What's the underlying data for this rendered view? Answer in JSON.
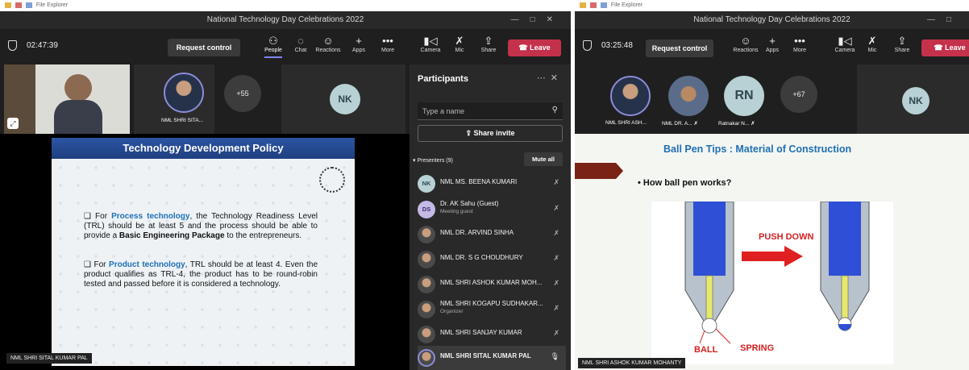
{
  "left_window": {
    "explorer_label": "File Explorer",
    "title": "National Technology Day Celebrations 2022",
    "timer": "02:47:39",
    "request_control": "Request control",
    "tools": [
      {
        "label": "People",
        "icon": "people-icon"
      },
      {
        "label": "Chat",
        "icon": "chat-icon"
      },
      {
        "label": "Reactions",
        "icon": "reactions-icon"
      },
      {
        "label": "Apps",
        "icon": "plus-icon"
      },
      {
        "label": "More",
        "icon": "more-icon"
      },
      {
        "label": "Camera",
        "icon": "camera-off-icon"
      },
      {
        "label": "Mic",
        "icon": "mic-off-icon"
      },
      {
        "label": "Share",
        "icon": "share-icon"
      }
    ],
    "leave": "Leave",
    "tiles": {
      "person2_name": "NML SHRI SITA...",
      "overflow_count": "+55",
      "nk_initials": "NK"
    },
    "slide": {
      "title": "Technology Development Policy",
      "bullet1": {
        "prefix": "For ",
        "highlight": "Process technology",
        "mid": ", the Technology Readiness Level (TRL) should be at least 5 and the process should be able to provide a ",
        "bold": "Basic Engineering Package",
        "suffix": " to the entrepreneurs."
      },
      "bullet2": {
        "prefix": "For ",
        "highlight": "Product technology",
        "suffix": ", TRL should be at least 4. Even the product qualifies as TRL-4, the product has to be round-robin tested and passed before it is considered a technology."
      }
    },
    "presenter_tag": "NML SHRI SITAL KUMAR PAL",
    "participants": {
      "title": "Participants",
      "search_placeholder": "Type a name",
      "share_invite": "Share invite",
      "presenters_label": "Presenters (9)",
      "mute_all": "Mute all",
      "list": [
        {
          "initials": "NK",
          "name": "NML MS. BEENA KUMARI",
          "sub": ""
        },
        {
          "initials": "DS",
          "name": "Dr. AK Sahu (Guest)",
          "sub": "Meeting guest"
        },
        {
          "initials": "",
          "name": "NML DR. ARVIND SINHA",
          "sub": ""
        },
        {
          "initials": "",
          "name": "NML DR. S G CHOUDHURY",
          "sub": ""
        },
        {
          "initials": "",
          "name": "NML SHRI ASHOK KUMAR MOH...",
          "sub": ""
        },
        {
          "initials": "",
          "name": "NML SHRI KOGAPU SUDHAKAR...",
          "sub": "Organizer"
        },
        {
          "initials": "",
          "name": "NML SHRI SANJAY KUMAR",
          "sub": ""
        },
        {
          "initials": "",
          "name": "NML SHRI SITAL KUMAR PAL",
          "sub": ""
        }
      ]
    }
  },
  "right_window": {
    "explorer_label": "File Explorer",
    "title": "National Technology Day Celebrations 2022",
    "timer": "03:25:48",
    "request_control": "Request control",
    "tools": [
      {
        "label": "Reactions",
        "icon": "reactions-icon"
      },
      {
        "label": "Apps",
        "icon": "plus-icon"
      },
      {
        "label": "More",
        "icon": "more-icon"
      },
      {
        "label": "Camera",
        "icon": "camera-off-icon"
      },
      {
        "label": "Mic",
        "icon": "mic-off-icon"
      },
      {
        "label": "Share",
        "icon": "share-icon"
      }
    ],
    "leave": "Leave",
    "tiles": {
      "t1_name": "NML SHRI ASH...",
      "t2_name": "NML DR. A...",
      "t3_initials": "RN",
      "t3_name": "Ratnakar N...",
      "overflow_count": "+67",
      "nk_initials": "NK"
    },
    "slide": {
      "title": "Ball Pen Tips : Material of Construction",
      "bullet": "How ball pen works?",
      "push_down": "PUSH DOWN",
      "ball": "BALL",
      "spring": "SPRING"
    },
    "presenter_tag": "NML SHRI ASHOK KUMAR MOHANTY"
  }
}
